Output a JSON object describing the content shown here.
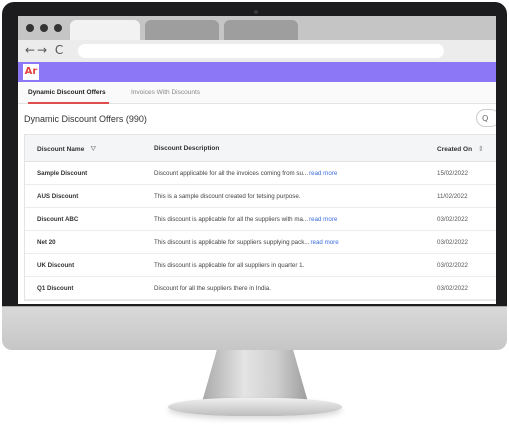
{
  "browser": {
    "nav_icons": "←→ C"
  },
  "app": {
    "logo_text": "Ar"
  },
  "tabs": [
    {
      "label": "Dynamic Discount Offers"
    },
    {
      "label": "Invoices With Discounts"
    }
  ],
  "page": {
    "title": "Dynamic Discount Offers (990)",
    "search_icon": "Q"
  },
  "table": {
    "columns": [
      "Discount Name",
      "Discount Description",
      "Created On"
    ],
    "read_more_label": "read more",
    "rows": [
      {
        "name": "Sample Discount",
        "description": "Discount applicable for all the invoices coming from su...",
        "read_more": "read more",
        "created_on": "15/02/2022"
      },
      {
        "name": "AUS Discount",
        "description": "This is a sample discount created for tetsing purpose.",
        "read_more": "",
        "created_on": "11/02/2022"
      },
      {
        "name": "Discount ABC",
        "description": "This discount is applicable for all the suppliers with ma...",
        "read_more": "read more",
        "created_on": "03/02/2022"
      },
      {
        "name": "Net 20",
        "description": "This discount is applicable for suppliers supplying pack...",
        "read_more": "read more",
        "created_on": "03/02/2022"
      },
      {
        "name": "UK Discount",
        "description": "This discount is applicable for all suppliers in quarter 1.",
        "read_more": "",
        "created_on": "03/02/2022"
      },
      {
        "name": "Q1 Discount",
        "description": "Discount for all the suppliers there in India.",
        "read_more": "",
        "created_on": "03/02/2022"
      }
    ]
  },
  "colors": {
    "header": "#8c78f6",
    "tab_underline": "#e04d4d",
    "link": "#3b6ee0"
  }
}
